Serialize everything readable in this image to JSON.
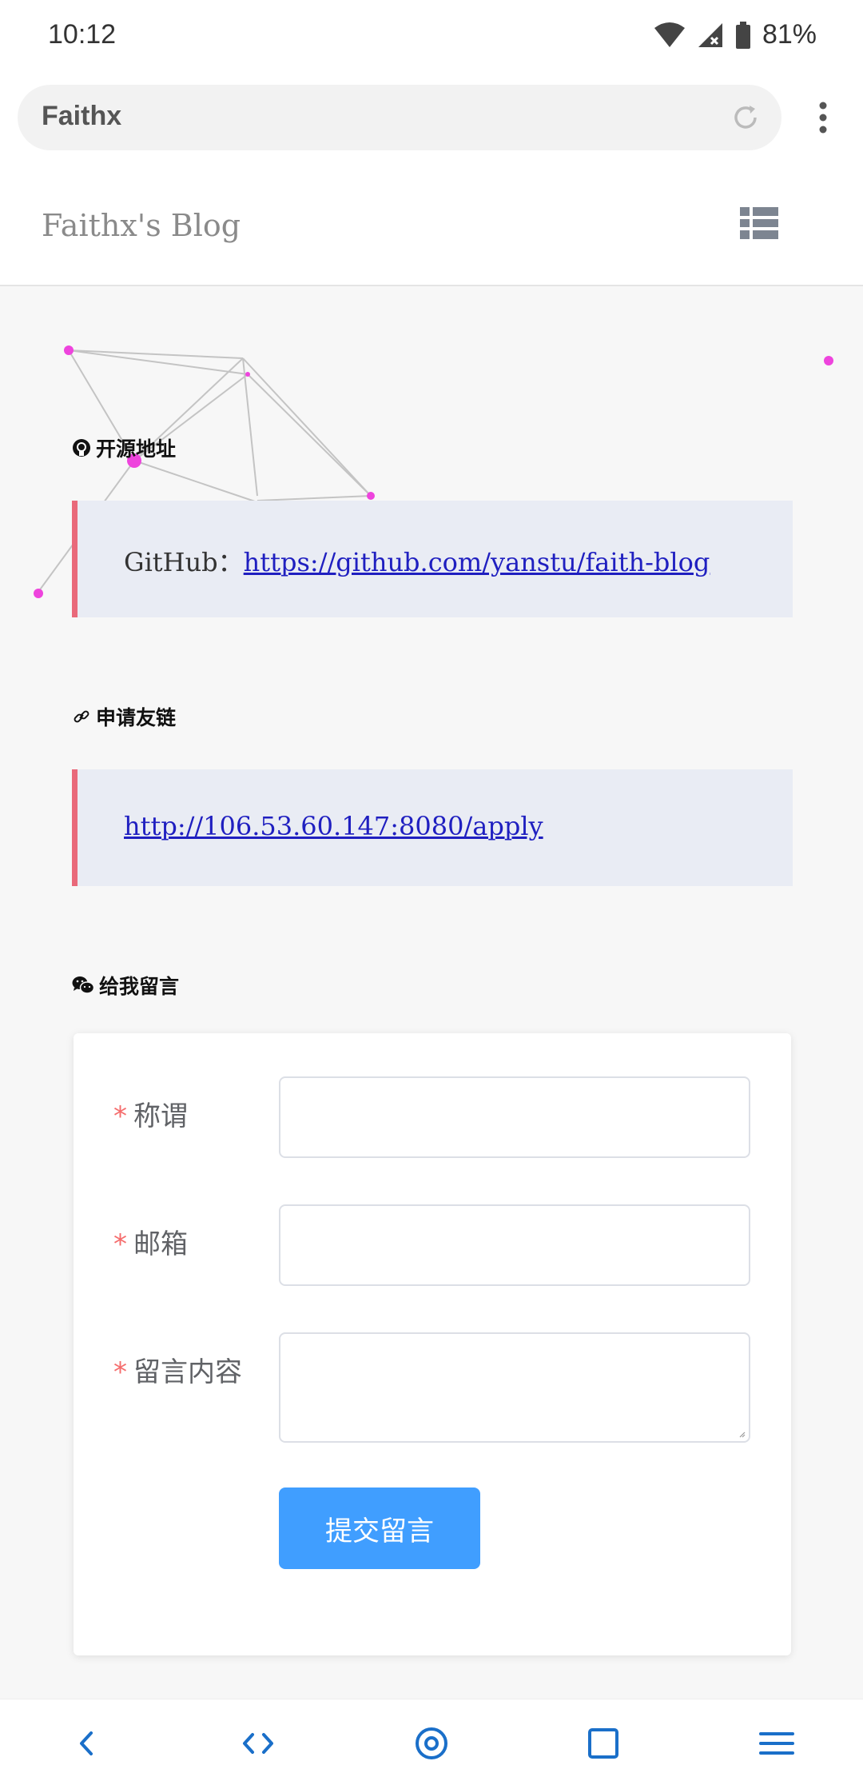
{
  "status_bar": {
    "time": "10:12",
    "battery": "81%"
  },
  "browser": {
    "url_text": "Faithx"
  },
  "blog": {
    "title": "Faithx's Blog"
  },
  "sections": {
    "open_source": {
      "title": "开源地址",
      "label": "GitHub：",
      "link": "https://github.com/yanstu/faith-blog"
    },
    "friend_link": {
      "title": "申请友链",
      "link": "http://106.53.60.147:8080/apply"
    },
    "message": {
      "title": "给我留言",
      "required_mark": "*",
      "fields": {
        "nickname_label": "称谓",
        "email_label": "邮箱",
        "content_label": "留言内容"
      },
      "submit_label": "提交留言"
    }
  },
  "colors": {
    "accent_blue": "#409eff",
    "quote_border": "#e9697a",
    "quote_bg": "#e9ecf4",
    "network_dot": "#ee44dd",
    "link": "#1f1fc0"
  }
}
